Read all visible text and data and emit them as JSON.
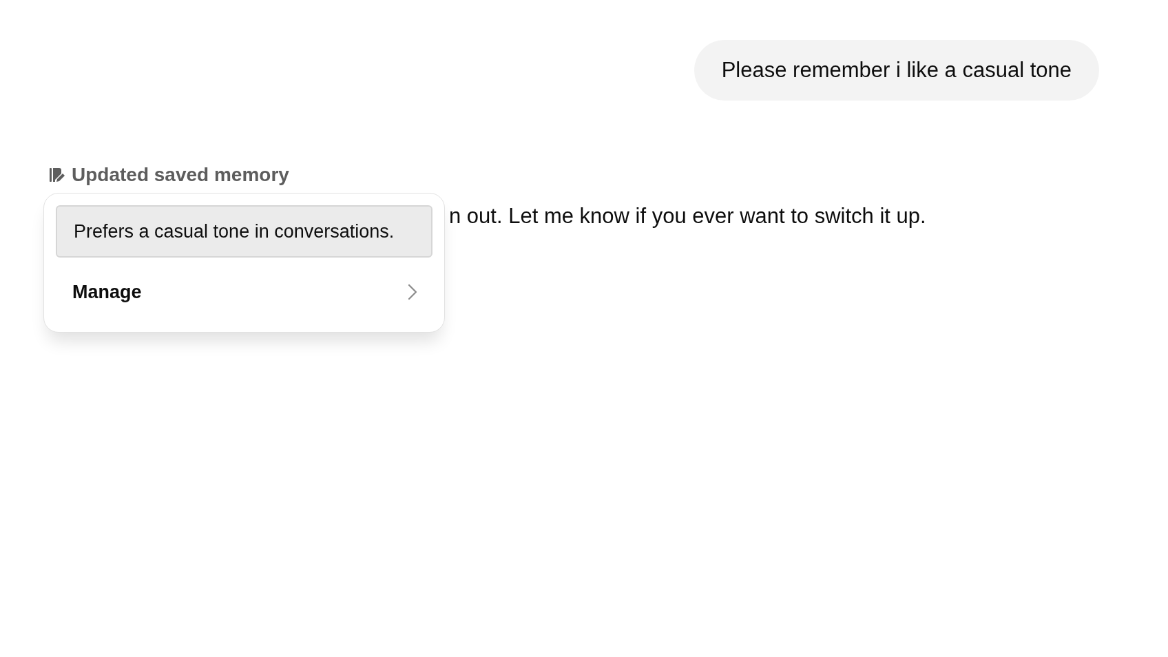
{
  "user_message": {
    "text": "Please remember i like a casual tone"
  },
  "memory_status": {
    "label": "Updated saved memory"
  },
  "reply": {
    "visible_text": "n out. Let me know if you ever want to switch it up."
  },
  "memory_popup": {
    "items": [
      {
        "text": "Prefers a casual tone in conversations."
      }
    ],
    "manage": {
      "label": "Manage"
    }
  }
}
